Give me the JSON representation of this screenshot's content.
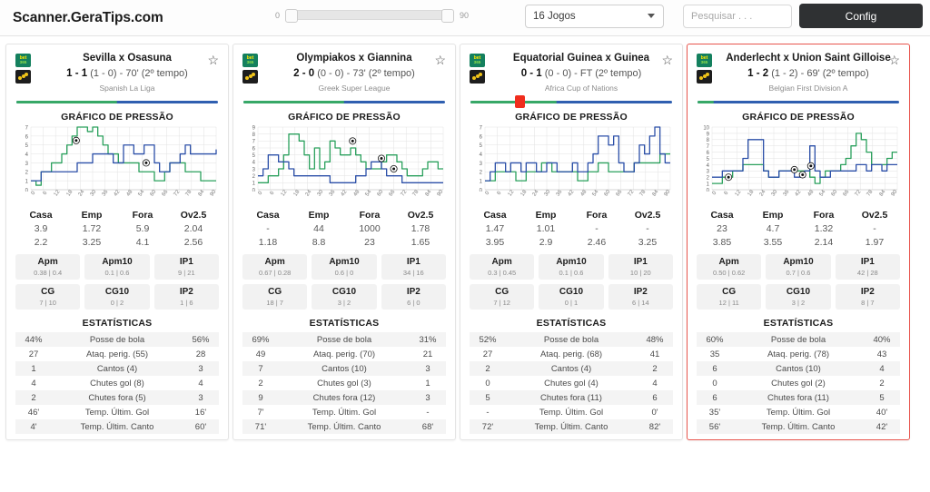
{
  "topbar": {
    "brand": "Scanner.GeraTips.com",
    "slider": {
      "min_label": "0",
      "max_label": "90",
      "min": 0,
      "max": 90,
      "value_min": 0,
      "value_max": 90
    },
    "games_select": {
      "value": "16 Jogos",
      "icon": "chevron-down-icon"
    },
    "search": {
      "placeholder": "Pesquisar . . .",
      "value": ""
    },
    "config_button": "Config"
  },
  "labels": {
    "chart_title": "GRÁFICO DE PRESSÃO",
    "stats_title": "ESTATÍSTICAS",
    "odds_heads": [
      "Casa",
      "Emp",
      "Fora",
      "Ov2.5"
    ],
    "chip_heads_row1": [
      "Apm",
      "Apm10",
      "IP1"
    ],
    "chip_heads_row2": [
      "CG",
      "CG10",
      "IP2"
    ],
    "stat_names": [
      "Posse de bola",
      "Ataq. perig.",
      "Cantos",
      "Chutes gol",
      "Chutes fora",
      "Temp. Últim. Gol",
      "Temp. Últim. Canto"
    ],
    "star_icon": "star-icon",
    "xticks": [
      "0",
      "6",
      "12",
      "18",
      "24",
      "30",
      "36",
      "42",
      "48",
      "54",
      "60",
      "66",
      "72",
      "78",
      "84",
      "90"
    ]
  },
  "colors": {
    "home_line": "#2aa05c",
    "away_line": "#2b4fa8",
    "selected_border": "#e8554d",
    "marker_red": "#f02d1d",
    "config_bg": "#2f3133"
  },
  "cards": [
    {
      "title": "Sevilla x Osasuna",
      "score": "1 - 1",
      "halftime": "(1 - 0)",
      "minute": "70'",
      "period": "(2º tempo)",
      "league": "Spanish La Liga",
      "progress_green_pct": 50,
      "marker_pct": null,
      "selected": false,
      "chart_data": {
        "type": "line",
        "title": "GRÁFICO DE PRESSÃO",
        "xlabel": "",
        "ylabel": "",
        "xlim": [
          0,
          90
        ],
        "ylim": [
          0,
          7
        ],
        "yticks": [
          0,
          1,
          2,
          3,
          4,
          5,
          6,
          7
        ],
        "xticks": [
          0,
          6,
          12,
          18,
          24,
          30,
          36,
          42,
          48,
          54,
          60,
          66,
          72,
          78,
          84,
          90
        ],
        "grid": true,
        "series": [
          {
            "name": "home",
            "color": "#2aa05c",
            "values": [
              1,
              0.5,
              2,
              2,
              3,
              3,
              4,
              5,
              6,
              7,
              7,
              6.5,
              7,
              6,
              5,
              4,
              4,
              3,
              3,
              3,
              3,
              2,
              2,
              2,
              1,
              1,
              2,
              3,
              3,
              3,
              2,
              2,
              2,
              1,
              1,
              1,
              1
            ]
          },
          {
            "name": "away",
            "color": "#2b4fa8",
            "values": [
              1,
              1,
              2,
              2,
              2,
              2,
              2,
              2,
              2,
              3,
              3,
              3,
              4,
              4,
              4,
              4,
              3,
              3,
              5,
              5,
              4,
              4,
              5,
              5,
              3,
              2,
              2,
              3,
              3,
              4,
              5,
              4,
              4,
              4,
              4,
              4,
              4.5
            ]
          }
        ],
        "goal_markers": [
          {
            "x": 22,
            "y": 5.5
          },
          {
            "x": 56,
            "y": 3.0
          }
        ]
      },
      "odds": {
        "casa": [
          "3.9",
          "2.2"
        ],
        "emp": [
          "1.72",
          "3.25"
        ],
        "fora": [
          "5.9",
          "4.1"
        ],
        "ov25": [
          "2.04",
          "2.56"
        ]
      },
      "chips": {
        "Apm": "0.38 | 0.4",
        "Apm10": "0.1 | 0.6",
        "IP1": "9 | 21",
        "CG": "7 | 10",
        "CG10": "0 | 2",
        "IP2": "1 | 6"
      },
      "stats": [
        {
          "name": "Posse de bola",
          "home": "44%",
          "away": "56%"
        },
        {
          "name": "Ataq. perig. (55)",
          "home": "27",
          "away": "28"
        },
        {
          "name": "Cantos (4)",
          "home": "1",
          "away": "3"
        },
        {
          "name": "Chutes gol (8)",
          "home": "4",
          "away": "4"
        },
        {
          "name": "Chutes fora (5)",
          "home": "2",
          "away": "3"
        },
        {
          "name": "Temp. Últim. Gol",
          "home": "46'",
          "away": "16'"
        },
        {
          "name": "Temp. Últim. Canto",
          "home": "4'",
          "away": "60'"
        }
      ]
    },
    {
      "title": "Olympiakos x Giannina",
      "score": "2 - 0",
      "halftime": "(0 - 0)",
      "minute": "73'",
      "period": "(2º tempo)",
      "league": "Greek Super League",
      "progress_green_pct": 50,
      "marker_pct": null,
      "selected": false,
      "chart_data": {
        "type": "line",
        "title": "GRÁFICO DE PRESSÃO",
        "xlabel": "",
        "ylabel": "",
        "xlim": [
          0,
          90
        ],
        "ylim": [
          0,
          9
        ],
        "yticks": [
          0,
          1,
          2,
          3,
          4,
          5,
          6,
          7,
          8,
          9
        ],
        "xticks": [
          0,
          6,
          12,
          18,
          24,
          30,
          36,
          42,
          48,
          54,
          60,
          66,
          72,
          78,
          84,
          90
        ],
        "grid": true,
        "series": [
          {
            "name": "home",
            "color": "#2aa05c",
            "values": [
              1,
              1,
              2,
              2,
              3,
              5,
              8,
              8,
              7,
              5,
              3,
              6,
              3,
              4,
              7,
              6,
              5,
              5,
              6,
              5,
              4,
              3,
              3,
              3,
              4,
              5,
              5,
              4,
              3,
              2,
              2,
              2,
              3,
              4,
              4,
              3,
              3
            ]
          },
          {
            "name": "away",
            "color": "#2b4fa8",
            "values": [
              2,
              3,
              5,
              5,
              4,
              4,
              3,
              2,
              2,
              2,
              2,
              2,
              2,
              2,
              1,
              1,
              1,
              1,
              1,
              2,
              2,
              3,
              4,
              4,
              3,
              2,
              2,
              2,
              1,
              1,
              1,
              1,
              1,
              1,
              1,
              1,
              1
            ]
          }
        ],
        "goal_markers": [
          {
            "x": 46,
            "y": 7.0
          },
          {
            "x": 60,
            "y": 4.5
          },
          {
            "x": 66,
            "y": 3.0
          }
        ]
      },
      "odds": {
        "casa": [
          "-",
          "1.18"
        ],
        "emp": [
          "44",
          "8.8"
        ],
        "fora": [
          "1000",
          "23"
        ],
        "ov25": [
          "1.78",
          "1.65"
        ]
      },
      "chips": {
        "Apm": "0.67 | 0.28",
        "Apm10": "0.6 | 0",
        "IP1": "34 | 16",
        "CG": "18 | 7",
        "CG10": "3 | 2",
        "IP2": "6 | 0"
      },
      "stats": [
        {
          "name": "Posse de bola",
          "home": "69%",
          "away": "31%"
        },
        {
          "name": "Ataq. perig. (70)",
          "home": "49",
          "away": "21"
        },
        {
          "name": "Cantos (10)",
          "home": "7",
          "away": "3"
        },
        {
          "name": "Chutes gol (3)",
          "home": "2",
          "away": "1"
        },
        {
          "name": "Chutes fora (12)",
          "home": "9",
          "away": "3"
        },
        {
          "name": "Temp. Últim. Gol",
          "home": "7'",
          "away": "-"
        },
        {
          "name": "Temp. Últim. Canto",
          "home": "71'",
          "away": "68'"
        }
      ]
    },
    {
      "title": "Equatorial Guinea x Guinea",
      "score": "0 - 1",
      "halftime": "(0 - 0)",
      "minute": "FT",
      "period": "(2º tempo)",
      "league": "Africa Cup of Nations",
      "progress_green_pct": 43,
      "marker_pct": 22,
      "selected": false,
      "chart_data": {
        "type": "line",
        "title": "GRÁFICO DE PRESSÃO",
        "xlabel": "",
        "ylabel": "",
        "xlim": [
          0,
          90
        ],
        "ylim": [
          0,
          7
        ],
        "yticks": [
          0,
          1,
          2,
          3,
          4,
          5,
          6,
          7
        ],
        "xticks": [
          0,
          6,
          12,
          18,
          24,
          30,
          36,
          42,
          48,
          54,
          60,
          66,
          72,
          78,
          84,
          90
        ],
        "grid": true,
        "series": [
          {
            "name": "home",
            "color": "#2aa05c",
            "values": [
              1,
              1,
              2,
              2,
              2,
              2,
              1,
              1,
              2,
              2,
              2,
              3,
              3,
              2,
              2,
              2,
              2,
              2,
              1,
              1,
              2,
              2,
              3,
              3,
              2,
              2,
              2,
              2,
              2,
              3,
              3,
              3,
              3,
              3,
              4,
              4,
              4
            ]
          },
          {
            "name": "away",
            "color": "#2b4fa8",
            "values": [
              1,
              2,
              3,
              3,
              2,
              3,
              3,
              2,
              3,
              3,
              2,
              2,
              3,
              3,
              2,
              2,
              2,
              3,
              2,
              2,
              3,
              4,
              6,
              6,
              5,
              6,
              3,
              2,
              2,
              3,
              5,
              4,
              6,
              7,
              4,
              3,
              3
            ]
          }
        ],
        "goal_markers": []
      },
      "odds": {
        "casa": [
          "1.47",
          "3.95"
        ],
        "emp": [
          "1.01",
          "2.9"
        ],
        "fora": [
          "-",
          "2.46"
        ],
        "ov25": [
          "-",
          "3.25"
        ]
      },
      "chips": {
        "Apm": "0.3 | 0.45",
        "Apm10": "0.1 | 0.6",
        "IP1": "10 | 20",
        "CG": "7 | 12",
        "CG10": "0 | 1",
        "IP2": "6 | 14"
      },
      "stats": [
        {
          "name": "Posse de bola",
          "home": "52%",
          "away": "48%"
        },
        {
          "name": "Ataq. perig. (68)",
          "home": "27",
          "away": "41"
        },
        {
          "name": "Cantos (4)",
          "home": "2",
          "away": "2"
        },
        {
          "name": "Chutes gol (4)",
          "home": "0",
          "away": "4"
        },
        {
          "name": "Chutes fora (11)",
          "home": "5",
          "away": "6"
        },
        {
          "name": "Temp. Últim. Gol",
          "home": "-",
          "away": "0'"
        },
        {
          "name": "Temp. Últim. Canto",
          "home": "72'",
          "away": "82'"
        }
      ]
    },
    {
      "title": "Anderlecht x Union Saint Gilloise",
      "score": "1 - 2",
      "halftime": "(1 - 2)",
      "minute": "69'",
      "period": "(2º tempo)",
      "league": "Belgian First Division A",
      "progress_green_pct": 8,
      "marker_pct": null,
      "selected": true,
      "chart_data": {
        "type": "line",
        "title": "GRÁFICO DE PRESSÃO",
        "xlabel": "",
        "ylabel": "",
        "xlim": [
          0,
          90
        ],
        "ylim": [
          0,
          10
        ],
        "yticks": [
          0,
          1,
          2,
          3,
          4,
          5,
          6,
          7,
          8,
          9,
          10
        ],
        "xticks": [
          0,
          6,
          12,
          18,
          24,
          30,
          36,
          42,
          48,
          54,
          60,
          66,
          72,
          78,
          84,
          90
        ],
        "grid": true,
        "series": [
          {
            "name": "home",
            "color": "#2aa05c",
            "values": [
              1,
              1,
              2,
              2,
              3,
              3,
              4,
              4,
              4,
              4,
              3,
              2,
              2,
              3,
              3,
              3,
              3,
              3,
              3,
              2,
              1,
              2,
              3,
              3,
              3,
              4,
              5,
              7,
              9,
              8,
              6,
              4,
              4,
              4,
              5,
              6,
              6
            ]
          },
          {
            "name": "away",
            "color": "#2b4fa8",
            "values": [
              2,
              2,
              3,
              3,
              3,
              3,
              5,
              8,
              8,
              8,
              3,
              2,
              2,
              3,
              3,
              3,
              2,
              2,
              3,
              7,
              3,
              2,
              2,
              3,
              3,
              3,
              3,
              3,
              4,
              4,
              3,
              4,
              4,
              3,
              4,
              4,
              4
            ]
          }
        ],
        "goal_markers": [
          {
            "x": 8,
            "y": 2.0
          },
          {
            "x": 40,
            "y": 3.2
          },
          {
            "x": 44,
            "y": 2.4
          },
          {
            "x": 48,
            "y": 3.8
          }
        ]
      },
      "odds": {
        "casa": [
          "23",
          "3.85"
        ],
        "emp": [
          "4.7",
          "3.55"
        ],
        "fora": [
          "1.32",
          "2.14"
        ],
        "ov25": [
          "-",
          "1.97"
        ]
      },
      "chips": {
        "Apm": "0.50 | 0.62",
        "Apm10": "0.7 | 0.6",
        "IP1": "42 | 28",
        "CG": "12 | 11",
        "CG10": "3 | 2",
        "IP2": "8 | 7"
      },
      "stats": [
        {
          "name": "Posse de bola",
          "home": "60%",
          "away": "40%"
        },
        {
          "name": "Ataq. perig. (78)",
          "home": "35",
          "away": "43"
        },
        {
          "name": "Cantos (10)",
          "home": "6",
          "away": "4"
        },
        {
          "name": "Chutes gol (2)",
          "home": "0",
          "away": "2"
        },
        {
          "name": "Chutes fora (11)",
          "home": "6",
          "away": "5"
        },
        {
          "name": "Temp. Últim. Gol",
          "home": "35'",
          "away": "40'"
        },
        {
          "name": "Temp. Últim. Canto",
          "home": "56'",
          "away": "42'"
        }
      ]
    }
  ]
}
